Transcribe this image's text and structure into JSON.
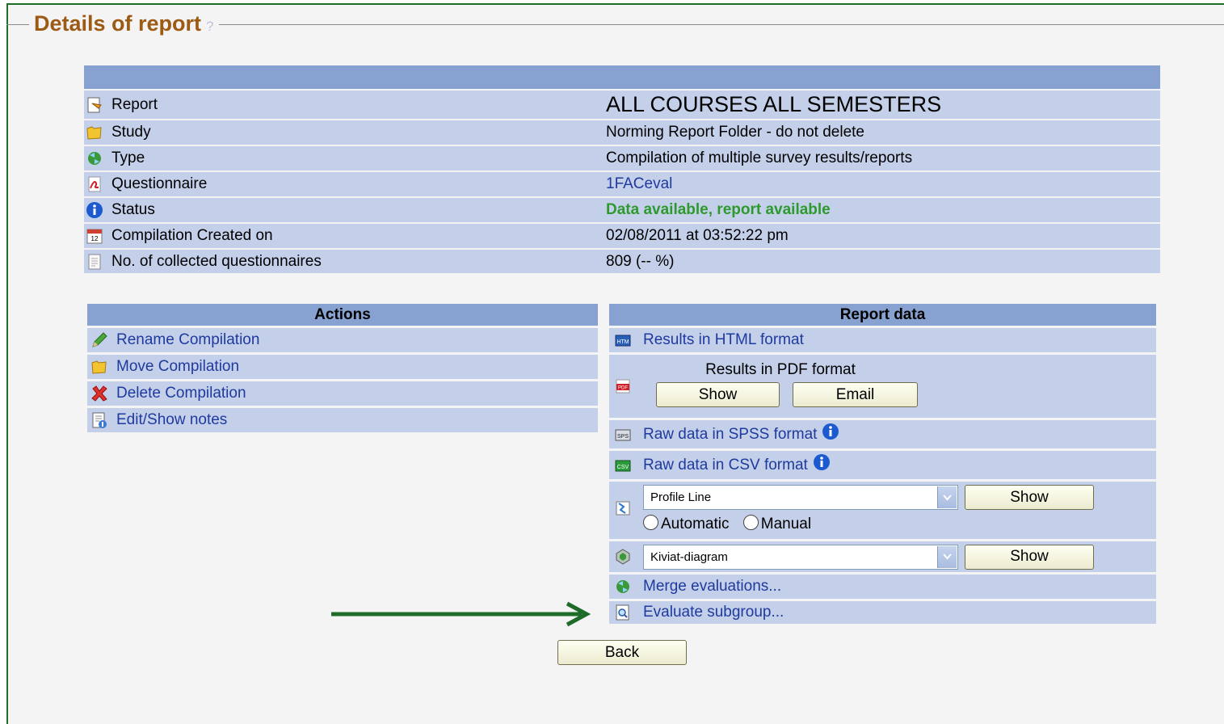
{
  "page": {
    "title": "Details of report",
    "help": "?"
  },
  "details": {
    "rows": [
      {
        "label": "Report",
        "value": "ALL COURSES ALL SEMESTERS",
        "icon": "report-icon"
      },
      {
        "label": "Study",
        "value": "Norming Report Folder - do not delete",
        "icon": "folder-icon"
      },
      {
        "label": "Type",
        "value": "Compilation of multiple survey results/reports",
        "icon": "compilation-icon"
      },
      {
        "label": "Questionnaire",
        "value": "1FACeval",
        "icon": "pdf-icon"
      },
      {
        "label": "Status",
        "value": "Data available, report available",
        "icon": "info-icon"
      },
      {
        "label": "Compilation Created on",
        "value": "02/08/2011 at 03:52:22 pm",
        "icon": "calendar-icon"
      },
      {
        "label": "No. of collected questionnaires",
        "value": "809 (-- %)",
        "icon": "document-icon"
      }
    ]
  },
  "actions": {
    "header": "Actions",
    "items": [
      {
        "label": "Rename Compilation",
        "icon": "pencil-icon"
      },
      {
        "label": "Move Compilation",
        "icon": "folder-icon"
      },
      {
        "label": "Delete Compilation",
        "icon": "delete-x-icon"
      },
      {
        "label": "Edit/Show notes",
        "icon": "notes-icon"
      }
    ]
  },
  "report_data": {
    "header": "Report data",
    "html_results": "Results in HTML format",
    "pdf": {
      "label": "Results in PDF format",
      "show": "Show",
      "email": "Email"
    },
    "spss": "Raw data in SPSS format",
    "csv": "Raw data in CSV format",
    "profile": {
      "selected": "Profile Line",
      "show": "Show",
      "automatic": "Automatic",
      "manual": "Manual"
    },
    "kiviat": {
      "selected": "Kiviat-diagram",
      "show": "Show"
    },
    "merge": "Merge evaluations...",
    "subgroup": "Evaluate subgroup..."
  },
  "back_label": "Back",
  "colors": {
    "status_green": "#2e9a2e",
    "link_blue": "#1f3a9e",
    "header_blue": "#87a2d0",
    "row_blue": "#c4d0ea",
    "title_brown": "#9c5a14",
    "arrow_green": "#1e6b2a"
  }
}
